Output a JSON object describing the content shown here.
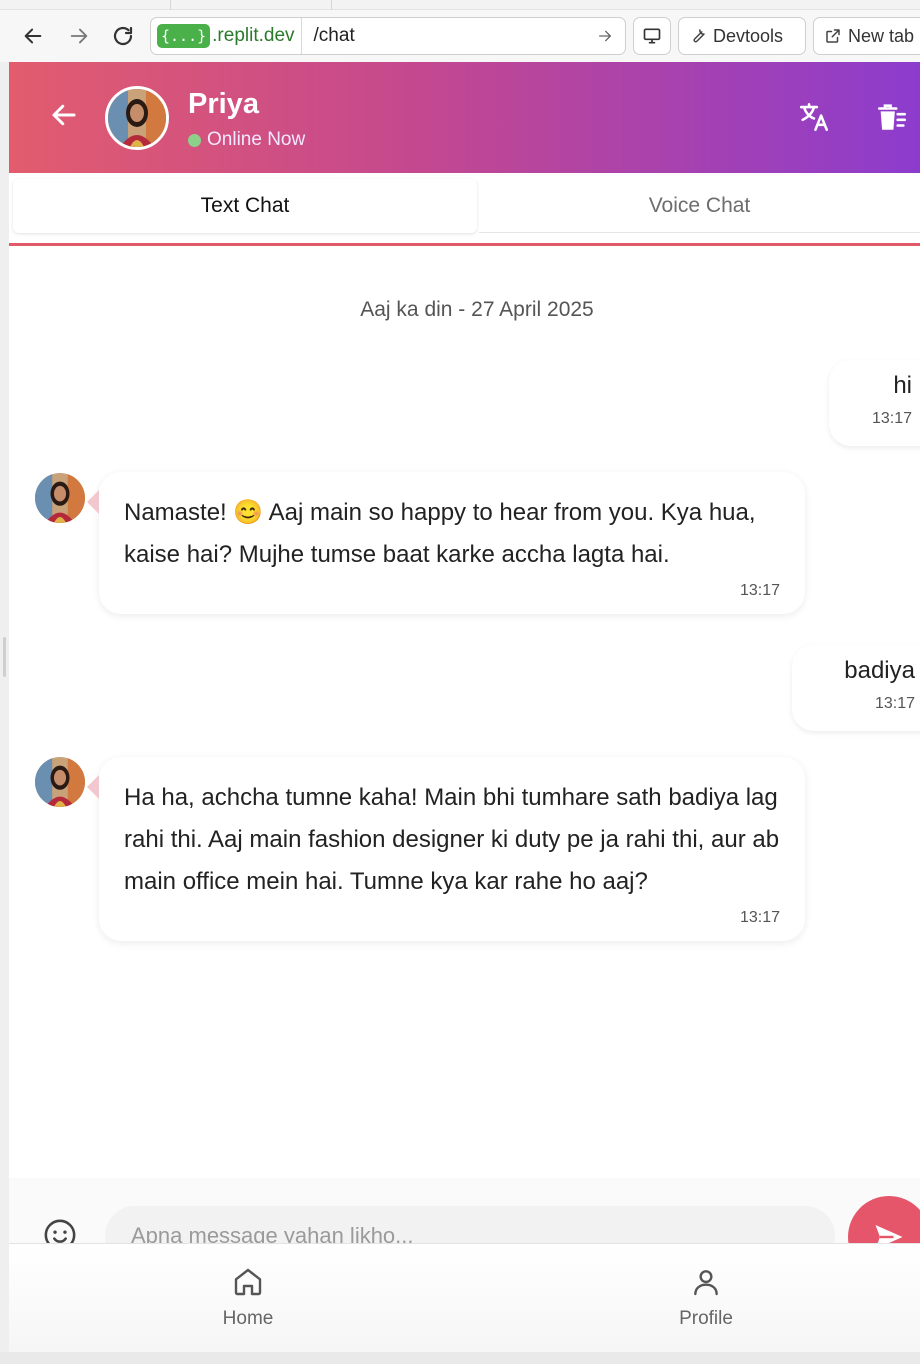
{
  "browser": {
    "host_badge": "{...}",
    "host": ".replit.dev",
    "path": "/chat",
    "devtools_label": "Devtools",
    "newtab_label": "New tab"
  },
  "header": {
    "name": "Priya",
    "status": "Online Now"
  },
  "tabs": [
    {
      "label": "Text Chat",
      "active": true
    },
    {
      "label": "Voice Chat",
      "active": false
    }
  ],
  "date_label": "Aaj ka din - 27 April 2025",
  "messages": [
    {
      "from": "user",
      "text": "hi",
      "time": "13:17"
    },
    {
      "from": "bot",
      "text": "Namaste! 😊 Aaj main so happy to hear from you. Kya hua, kaise hai? Mujhe tumse baat karke accha lagta hai.",
      "time": "13:17"
    },
    {
      "from": "user",
      "text": "badiya",
      "time": "13:17"
    },
    {
      "from": "bot",
      "text": "Ha ha, achcha tumne kaha! Main bhi tumhare sath badiya lag rahi thi. Aaj main fashion designer ki duty pe ja rahi thi, aur ab main office mein hai. Tumne kya kar rahe ho aaj?",
      "time": "13:17"
    }
  ],
  "composer": {
    "placeholder": "Apna message yahan likho..."
  },
  "nav": [
    {
      "label": "Home",
      "icon": "home-icon"
    },
    {
      "label": "Profile",
      "icon": "user-icon"
    }
  ],
  "colors": {
    "header_gradient_start": "#e25c6e",
    "header_gradient_end": "#8c3ccd",
    "accent": "#e5566b",
    "online": "#8dd08a"
  }
}
